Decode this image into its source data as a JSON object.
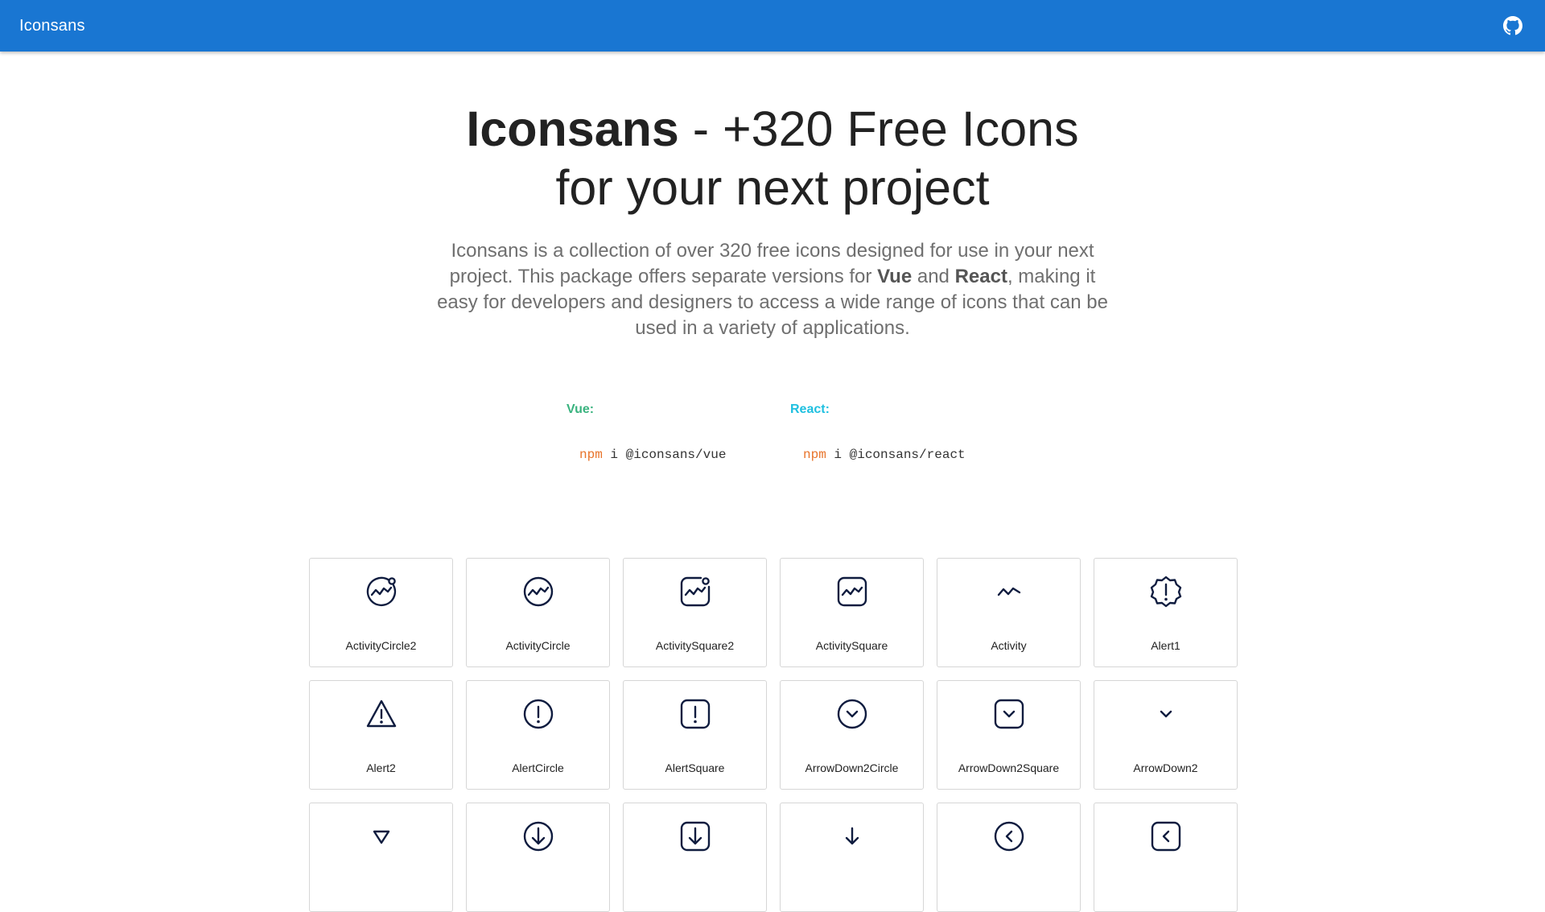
{
  "appbar": {
    "title": "Iconsans",
    "github_icon": "github-icon"
  },
  "hero": {
    "title_bold": "Iconsans",
    "title_rest": " - +320 Free Icons for your next project",
    "desc_1": "Iconsans is a collection of over 320 free icons designed for use in your next project. This package offers separate versions for ",
    "desc_vue": "Vue",
    "desc_and": " and ",
    "desc_react": "React",
    "desc_2": ", making it easy for developers and designers to access a wide range of icons that can be used in a variety of applications."
  },
  "install": {
    "vue": {
      "label": "Vue:",
      "npm": "npm",
      "rest": " i @iconsans/vue",
      "color": "#3ab37f"
    },
    "react": {
      "label": "React:",
      "npm": "npm",
      "rest": " i @iconsans/react",
      "color": "#1fc0e0"
    }
  },
  "icons": [
    {
      "name": "ActivityCircle2",
      "icon": "activity-circle-2-icon"
    },
    {
      "name": "ActivityCircle",
      "icon": "activity-circle-icon"
    },
    {
      "name": "ActivitySquare2",
      "icon": "activity-square-2-icon"
    },
    {
      "name": "ActivitySquare",
      "icon": "activity-square-icon"
    },
    {
      "name": "Activity",
      "icon": "activity-icon"
    },
    {
      "name": "Alert1",
      "icon": "alert-1-icon"
    },
    {
      "name": "Alert2",
      "icon": "alert-2-icon"
    },
    {
      "name": "AlertCircle",
      "icon": "alert-circle-icon"
    },
    {
      "name": "AlertSquare",
      "icon": "alert-square-icon"
    },
    {
      "name": "ArrowDown2Circle",
      "icon": "arrow-down-2-circle-icon"
    },
    {
      "name": "ArrowDown2Square",
      "icon": "arrow-down-2-square-icon"
    },
    {
      "name": "ArrowDown2",
      "icon": "arrow-down-2-icon"
    },
    {
      "name": "",
      "icon": "arrow-down-triangle-icon"
    },
    {
      "name": "",
      "icon": "arrow-down-circle-icon"
    },
    {
      "name": "",
      "icon": "arrow-down-square-icon"
    },
    {
      "name": "",
      "icon": "arrow-down-icon"
    },
    {
      "name": "",
      "icon": "arrow-left-2-circle-icon"
    },
    {
      "name": "",
      "icon": "arrow-left-2-square-icon"
    }
  ],
  "colors": {
    "appbar": "#1976d2",
    "icon_stroke": "#0f1c3f"
  }
}
